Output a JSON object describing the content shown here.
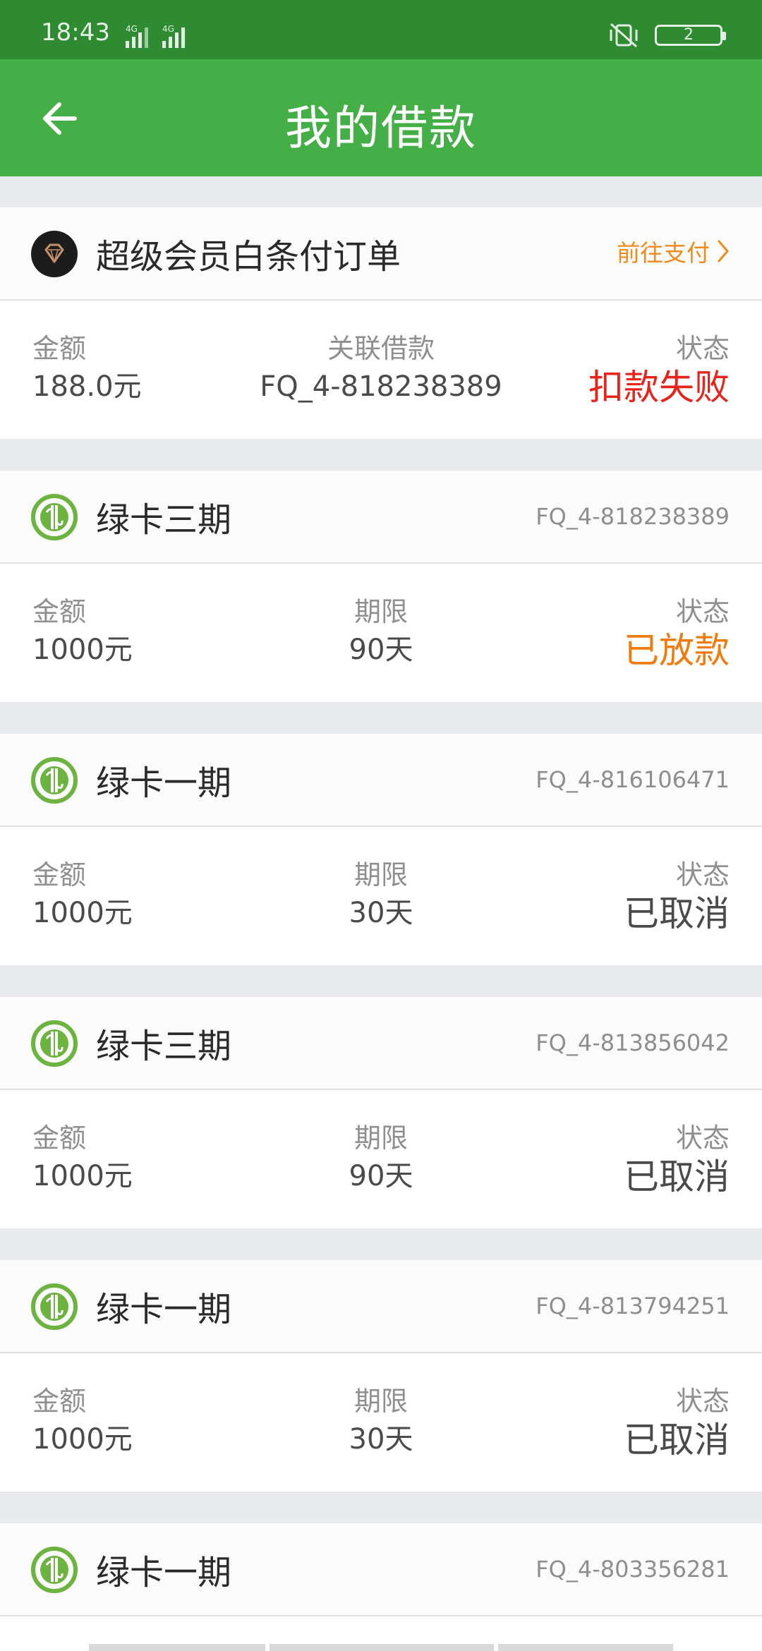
{
  "statusbar": {
    "time": "18:43",
    "signal1": "4G",
    "signal2": "4G",
    "battery": "2"
  },
  "appbar": {
    "title": "我的借款"
  },
  "order": {
    "title": "超级会员白条付订单",
    "link_label": "前往支付",
    "amount_label": "金额",
    "amount": "188.0元",
    "loan_label": "关联借款",
    "loan": "FQ_4-818238389",
    "status_label": "状态",
    "status": "扣款失败",
    "status_color": "#e8231b"
  },
  "loans": [
    {
      "title": "绿卡三期",
      "id": "FQ_4-818238389",
      "amount_label": "金额",
      "amount": "1000元",
      "term_label": "期限",
      "term": "90天",
      "status_label": "状态",
      "status": "已放款"
    },
    {
      "title": "绿卡一期",
      "id": "FQ_4-816106471",
      "amount_label": "金额",
      "amount": "1000元",
      "term_label": "期限",
      "term": "30天",
      "status_label": "状态",
      "status": "已取消"
    },
    {
      "title": "绿卡三期",
      "id": "FQ_4-813856042",
      "amount_label": "金额",
      "amount": "1000元",
      "term_label": "期限",
      "term": "90天",
      "status_label": "状态",
      "status": "已取消"
    },
    {
      "title": "绿卡一期",
      "id": "FQ_4-813794251",
      "amount_label": "金额",
      "amount": "1000元",
      "term_label": "期限",
      "term": "30天",
      "status_label": "状态",
      "status": "已取消"
    },
    {
      "title": "绿卡一期",
      "id": "FQ_4-803356281"
    }
  ],
  "colors": {
    "brand_green": "#44af47",
    "status_dispensed": "#f07b0e",
    "link_orange": "#f08a19"
  },
  "icons": {
    "back": "arrow-left-icon",
    "vip": "diamond-icon",
    "green_card": "green-card-logo-icon",
    "chevron": "chevron-right-icon"
  }
}
